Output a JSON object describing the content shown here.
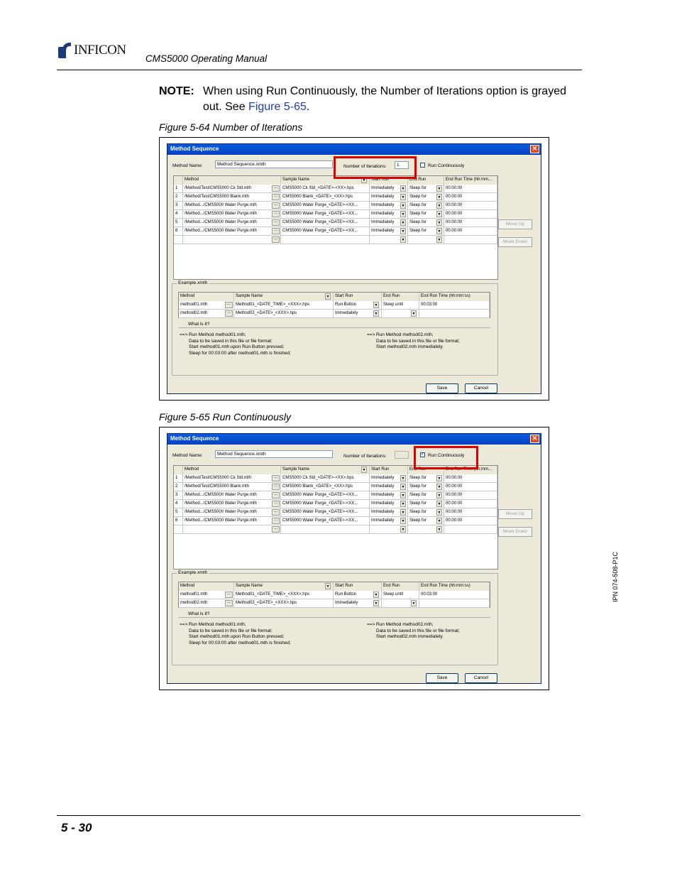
{
  "header": {
    "logo_text": "INFICON",
    "doc_title": "CMS5000 Operating Manual"
  },
  "note": {
    "label": "NOTE:",
    "text": "When using Run Continuously, the Number of Iterations option is grayed out. See ",
    "link": "Figure 5-65",
    "end": "."
  },
  "figures": [
    {
      "caption": "Figure 5-64  Number of Iterations",
      "highlight": "iterations",
      "iterations_value": "1",
      "run_continuously_checked": false
    },
    {
      "caption": "Figure 5-65  Run Continuously",
      "highlight": "run_continuously",
      "iterations_value": "",
      "run_continuously_checked": true
    }
  ],
  "dialog": {
    "title": "Method Sequence",
    "method_name_label": "Method Name:",
    "method_name_value": "Method Sequence.xmth",
    "iterations_label": "Number of Iterations:",
    "run_continuously_label": "Run Continuously",
    "check_mark": "✓",
    "close_glyph": "✕",
    "columns": [
      "",
      "Method",
      "Sample Name",
      "Start Run",
      "End Run",
      "End Run Time (hh:mm..."
    ],
    "rows": [
      {
        "n": "1",
        "method": "/Method/Test/CMS5000 Ck Std.mth",
        "sample": "CMS5000 Ck Std_<DATE>-<XX>.hps",
        "start": "Immediately",
        "end": "Sleep for",
        "time": "00:00:00"
      },
      {
        "n": "2",
        "method": "/Method/Test/CMS5000 Blank.mth",
        "sample": "CMS5000 Blank_<DATE>_<XX>.hps",
        "start": "Immediately",
        "end": "Sleep for",
        "time": "00:00:00"
      },
      {
        "n": "3",
        "method": "/Method.../CMS5000 Water Purge.mth",
        "sample": "CMS5000 Water Purge_<DATE>-<XX...",
        "start": "Immediately",
        "end": "Sleep for",
        "time": "00:00:00"
      },
      {
        "n": "4",
        "method": "/Method.../CMS5000 Water Purge.mth",
        "sample": "CMS5000 Water Purge_<DATE>-<XX...",
        "start": "Immediately",
        "end": "Sleep for",
        "time": "00:00:00"
      },
      {
        "n": "5",
        "method": "/Method.../CMS5000 Water Purge.mth",
        "sample": "CMS5000 Water Purge_<DATE>-<XX...",
        "start": "Immediately",
        "end": "Sleep for",
        "time": "00:00:00"
      },
      {
        "n": "6",
        "method": "/Method.../CMS5000 Water Purge.mth",
        "sample": "CMS5000 Water Purge_<DATE>-<XX...",
        "start": "Immediately",
        "end": "Sleep for",
        "time": "00:00:00"
      }
    ],
    "browse_glyph": "...",
    "dropdown_glyph": "▼",
    "move_up": "Move Up",
    "move_down": "Move Down",
    "example_title": "Example.xmth",
    "example_columns": [
      "Method",
      "Sample Name",
      "Start Run",
      "End Run",
      "End Run Time (hh:mm:ss)"
    ],
    "example_rows": [
      {
        "method": "method01.mth",
        "sample": "Method01_<DATE_TIME>_<XXX>.hps",
        "start": "Run Button",
        "end": "Sleep until",
        "time": "00:03:00"
      },
      {
        "method": "method02.mth",
        "sample": "Method02_<DATE>_<XXX>.hps",
        "start": "Immediately",
        "end": "",
        "time": ""
      }
    ],
    "what_is_it": "What is it?",
    "arrow": "==>",
    "explain_left": [
      "Run Method method01.mth;",
      "Data to be saved in this file or file format;",
      "Start method01.mth upon Run Button pressed;",
      "Sleep for 00:03:00 after method01.mth is finished;"
    ],
    "explain_right": [
      "Run Method method02.mth;",
      "Data to be saved in this file or file format;",
      "Start method02.mth immediately."
    ],
    "save": "Save",
    "cancel": "Cancel"
  },
  "side_id": "IPN 074-508-P1C",
  "footer": {
    "page_number": "5 - 30"
  }
}
